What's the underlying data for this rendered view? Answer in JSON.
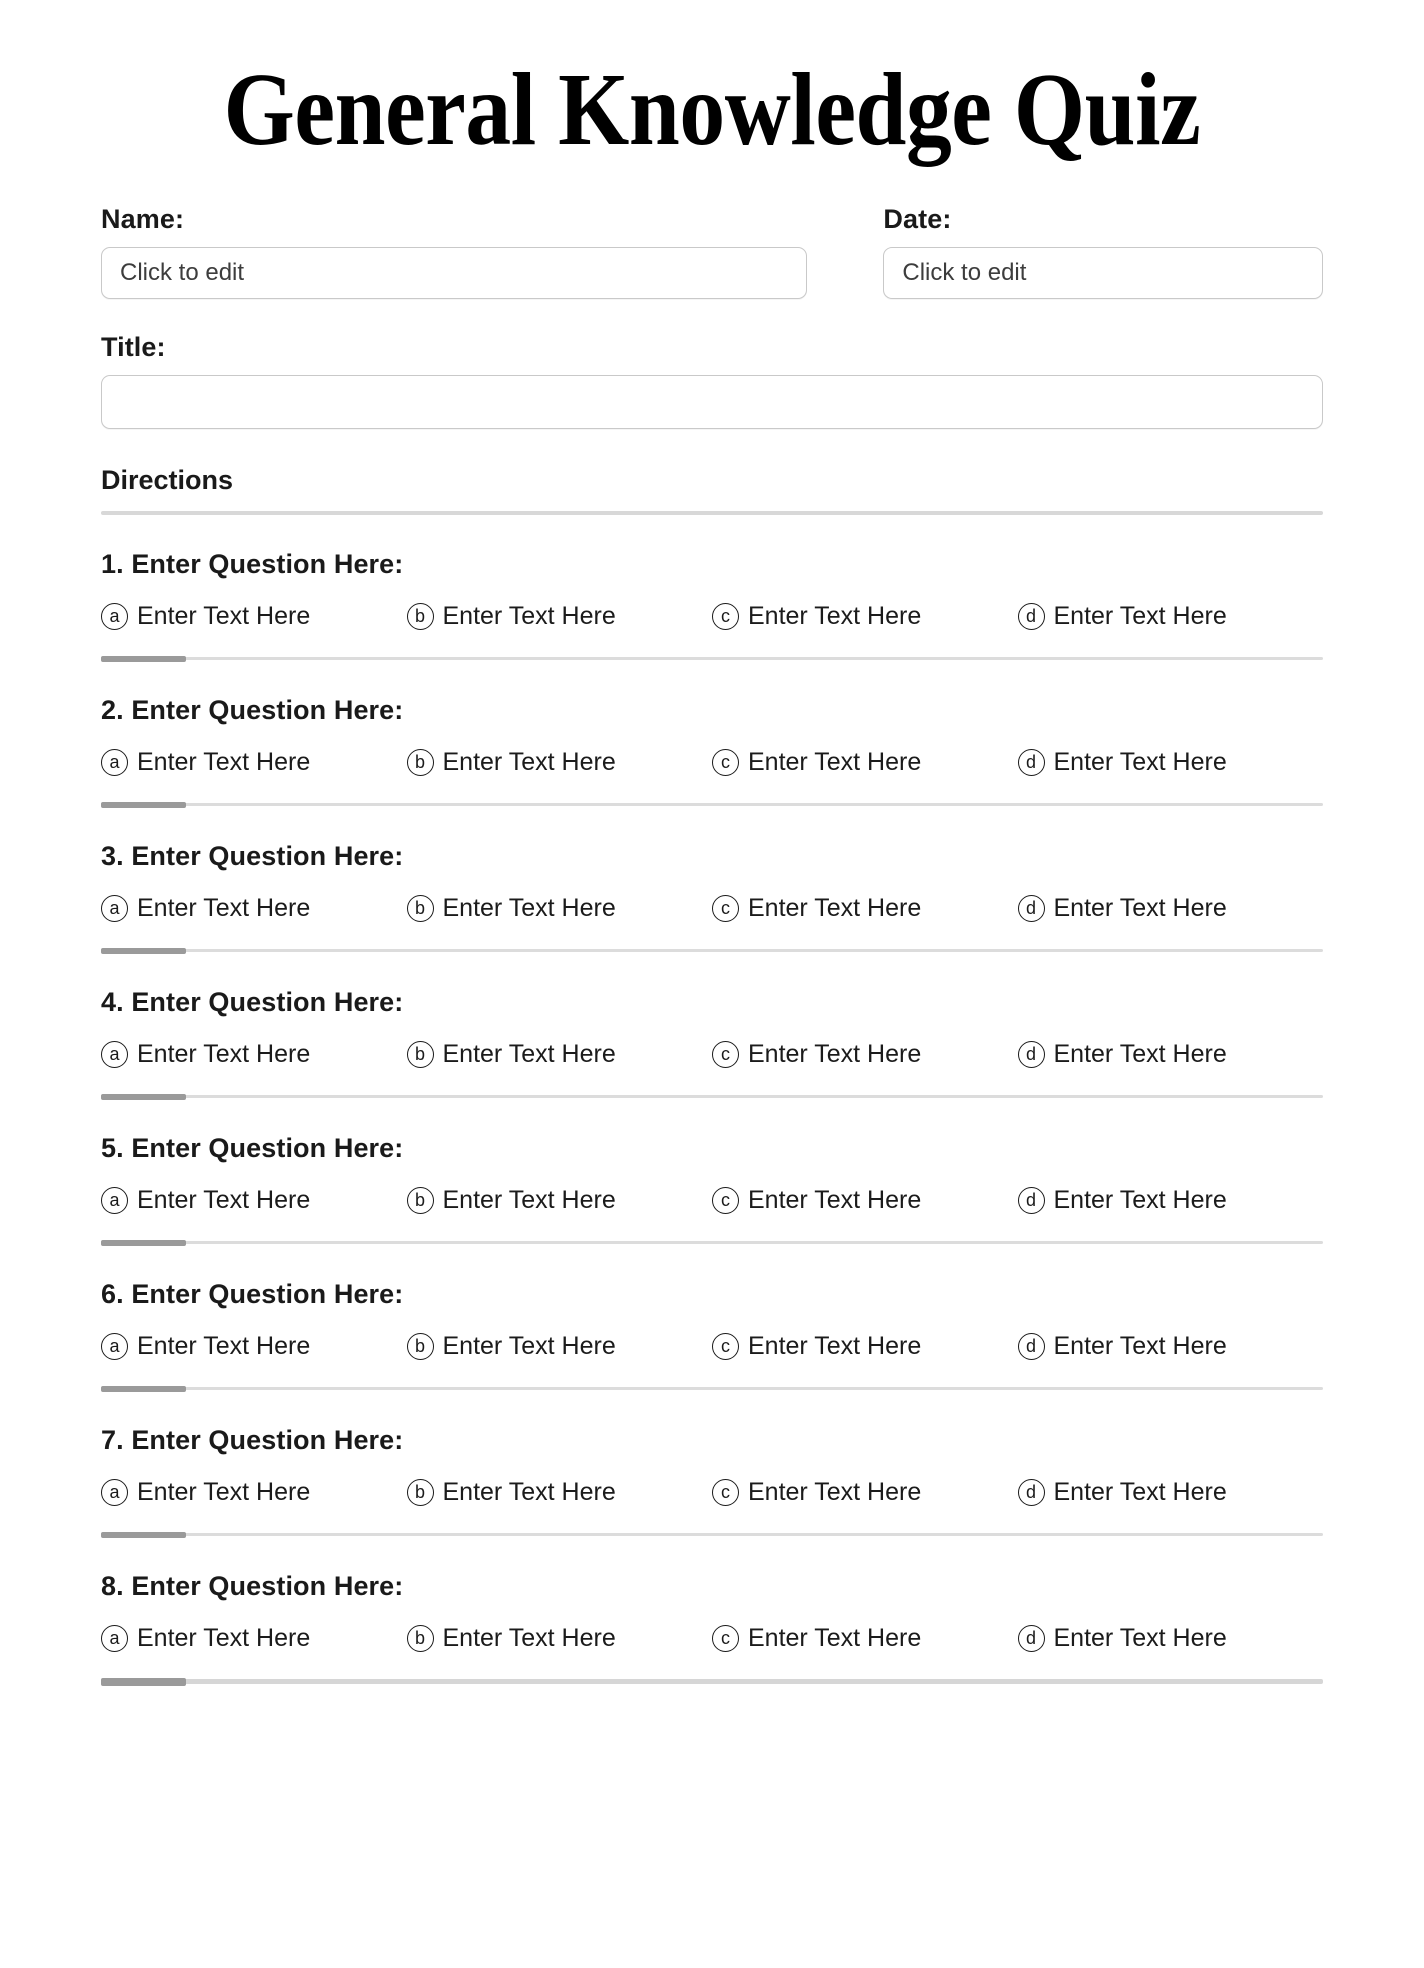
{
  "document": {
    "title": "General Knowledge Quiz"
  },
  "fields": {
    "name": {
      "label": "Name:",
      "value": "",
      "placeholder": "Click to edit"
    },
    "date": {
      "label": "Date:",
      "value": "",
      "placeholder": "Click to edit"
    },
    "title": {
      "label": "Title:",
      "value": "",
      "placeholder": ""
    }
  },
  "directions": {
    "heading": "Directions",
    "text": ""
  },
  "questions": [
    {
      "heading": "1. Enter Question Here:",
      "options": [
        {
          "letter": "a",
          "text": "Enter Text Here"
        },
        {
          "letter": "b",
          "text": "Enter Text Here"
        },
        {
          "letter": "c",
          "text": "Enter Text Here"
        },
        {
          "letter": "d",
          "text": "Enter Text Here"
        }
      ]
    },
    {
      "heading": "2. Enter Question Here:",
      "options": [
        {
          "letter": "a",
          "text": "Enter Text Here"
        },
        {
          "letter": "b",
          "text": "Enter Text Here"
        },
        {
          "letter": "c",
          "text": "Enter Text Here"
        },
        {
          "letter": "d",
          "text": "Enter Text Here"
        }
      ]
    },
    {
      "heading": "3. Enter Question Here:",
      "options": [
        {
          "letter": "a",
          "text": "Enter Text Here"
        },
        {
          "letter": "b",
          "text": "Enter Text Here"
        },
        {
          "letter": "c",
          "text": "Enter Text Here"
        },
        {
          "letter": "d",
          "text": "Enter Text Here"
        }
      ]
    },
    {
      "heading": "4. Enter Question Here:",
      "options": [
        {
          "letter": "a",
          "text": "Enter Text Here"
        },
        {
          "letter": "b",
          "text": "Enter Text Here"
        },
        {
          "letter": "c",
          "text": "Enter Text Here"
        },
        {
          "letter": "d",
          "text": "Enter Text Here"
        }
      ]
    },
    {
      "heading": "5. Enter Question Here:",
      "options": [
        {
          "letter": "a",
          "text": "Enter Text Here"
        },
        {
          "letter": "b",
          "text": "Enter Text Here"
        },
        {
          "letter": "c",
          "text": "Enter Text Here"
        },
        {
          "letter": "d",
          "text": "Enter Text Here"
        }
      ]
    },
    {
      "heading": "6. Enter Question Here:",
      "options": [
        {
          "letter": "a",
          "text": "Enter Text Here"
        },
        {
          "letter": "b",
          "text": "Enter Text Here"
        },
        {
          "letter": "c",
          "text": "Enter Text Here"
        },
        {
          "letter": "d",
          "text": "Enter Text Here"
        }
      ]
    },
    {
      "heading": "7. Enter Question Here:",
      "options": [
        {
          "letter": "a",
          "text": "Enter Text Here"
        },
        {
          "letter": "b",
          "text": "Enter Text Here"
        },
        {
          "letter": "c",
          "text": "Enter Text Here"
        },
        {
          "letter": "d",
          "text": "Enter Text Here"
        }
      ]
    },
    {
      "heading": "8. Enter Question Here:",
      "options": [
        {
          "letter": "a",
          "text": "Enter Text Here"
        },
        {
          "letter": "b",
          "text": "Enter Text Here"
        },
        {
          "letter": "c",
          "text": "Enter Text Here"
        },
        {
          "letter": "d",
          "text": "Enter Text Here"
        }
      ]
    }
  ],
  "colors": {
    "page_background": "#ffffff",
    "text": "#1b1b1b",
    "field_border": "#c9c9c9",
    "placeholder_text": "#3d3d3d",
    "divider_track": "#dcdcdc",
    "divider_thumb": "#9a9a9a"
  }
}
